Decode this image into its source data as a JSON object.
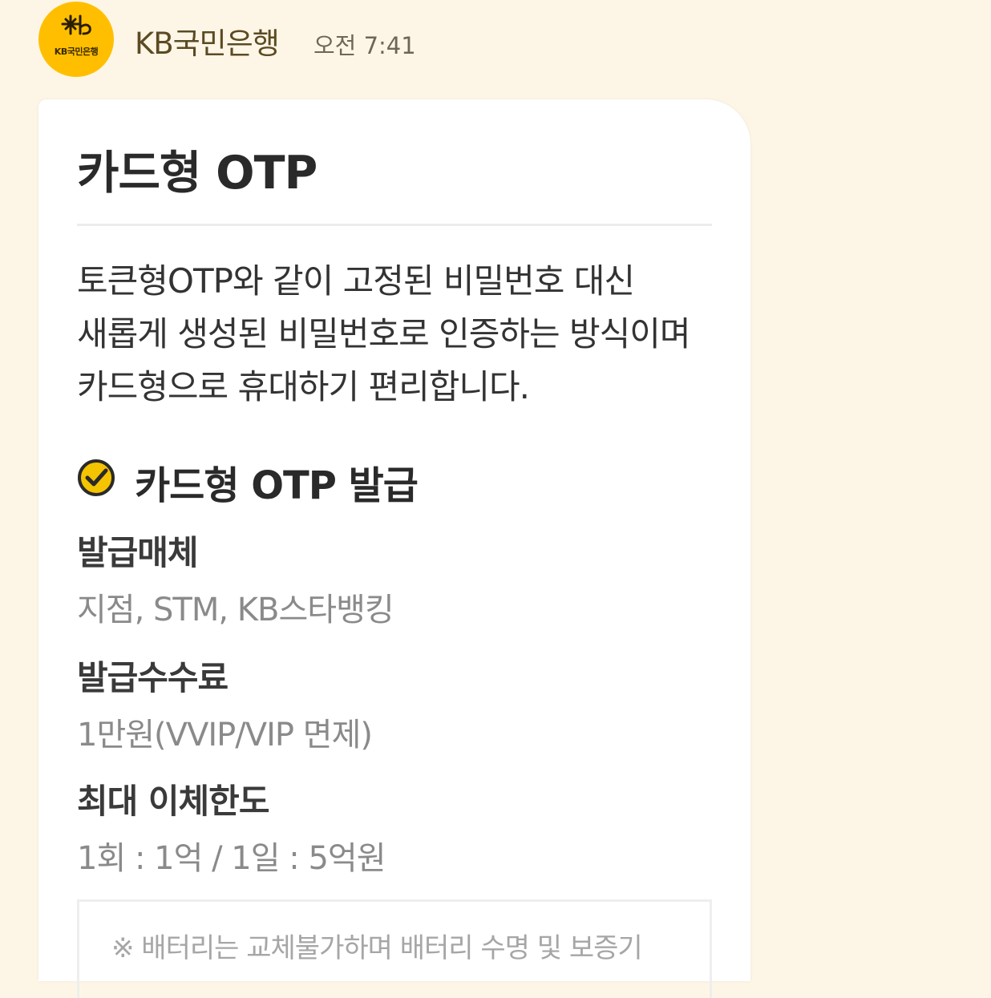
{
  "header": {
    "avatar_text": "KB국민은행",
    "sender": "KB국민은행",
    "time": "오전 7:41"
  },
  "card": {
    "title": "카드형 OTP",
    "description": "토큰형OTP와 같이 고정된 비밀번호 대신 새롭게 생성된 비밀번호로 인증하는 방식이며 카드형으로 휴대하기 편리합니다.",
    "section_title": "카드형 OTP 발급",
    "details": [
      {
        "label": "발급매체",
        "value": "지점, STM, KB스타뱅킹"
      },
      {
        "label": "발급수수료",
        "value": "1만원(VVIP/VIP 면제)"
      },
      {
        "label": "최대 이체한도",
        "value": "1회 : 1억 / 1일 : 5억원"
      }
    ],
    "note": "※ 배터리는 교체불가하며 배터리 수명 및 보증기"
  },
  "colors": {
    "background": "#fdf6e6",
    "brand_yellow": "#ffbf00",
    "check_icon_fill": "#f5c400"
  },
  "icons": {
    "avatar": "kb-logo-icon",
    "section": "check-circle-icon"
  }
}
